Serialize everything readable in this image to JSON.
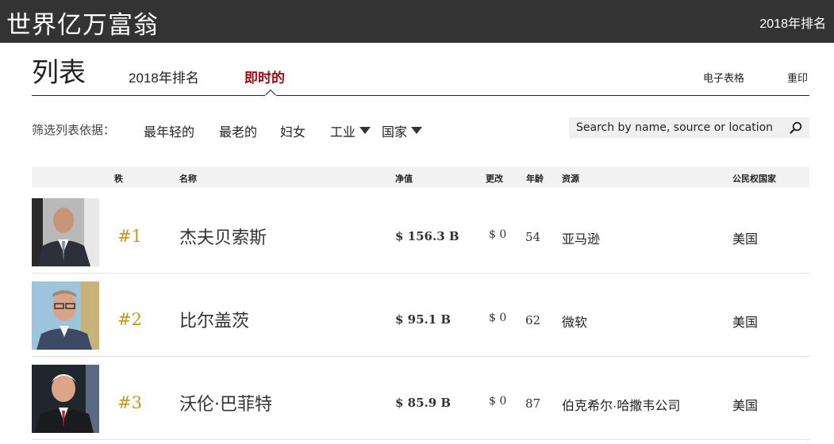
{
  "header": {
    "brand": "世界亿万富翁",
    "year_link": "2018年排名"
  },
  "page": {
    "title": "列表"
  },
  "tabs": [
    {
      "label": "2018年排名",
      "active": false
    },
    {
      "label": "即时的",
      "active": true
    }
  ],
  "actions": {
    "spreadsheet": "电子表格",
    "print": "重印"
  },
  "filters": {
    "label": "筛选列表依据：",
    "items": [
      "最年轻的",
      "最老的",
      "妇女",
      "工业",
      "国家"
    ]
  },
  "search": {
    "placeholder": "Search by name, source or location",
    "icon": "search-icon"
  },
  "table": {
    "headers": {
      "rank": "秩",
      "name": "名称",
      "net_worth": "净值",
      "change": "更改",
      "age": "年龄",
      "source": "资源",
      "country": "公民权国家"
    },
    "rows": [
      {
        "rank": "#1",
        "name": "杰夫贝索斯",
        "net_worth": "$ 156.3 B",
        "change": "$ 0",
        "age": "54",
        "source": "亚马逊",
        "country": "美国"
      },
      {
        "rank": "#2",
        "name": "比尔盖茨",
        "net_worth": "$ 95.1 B",
        "change": "$ 0",
        "age": "62",
        "source": "微软",
        "country": "美国"
      },
      {
        "rank": "#3",
        "name": "沃伦·巴菲特",
        "net_worth": "$ 85.9 B",
        "change": "$ 0",
        "age": "87",
        "source": "伯克希尔·哈撒韦公司",
        "country": "美国"
      }
    ]
  },
  "colors": {
    "topbar": "#333333",
    "active_tab": "#9b0b14",
    "rank": "#c9951f"
  }
}
